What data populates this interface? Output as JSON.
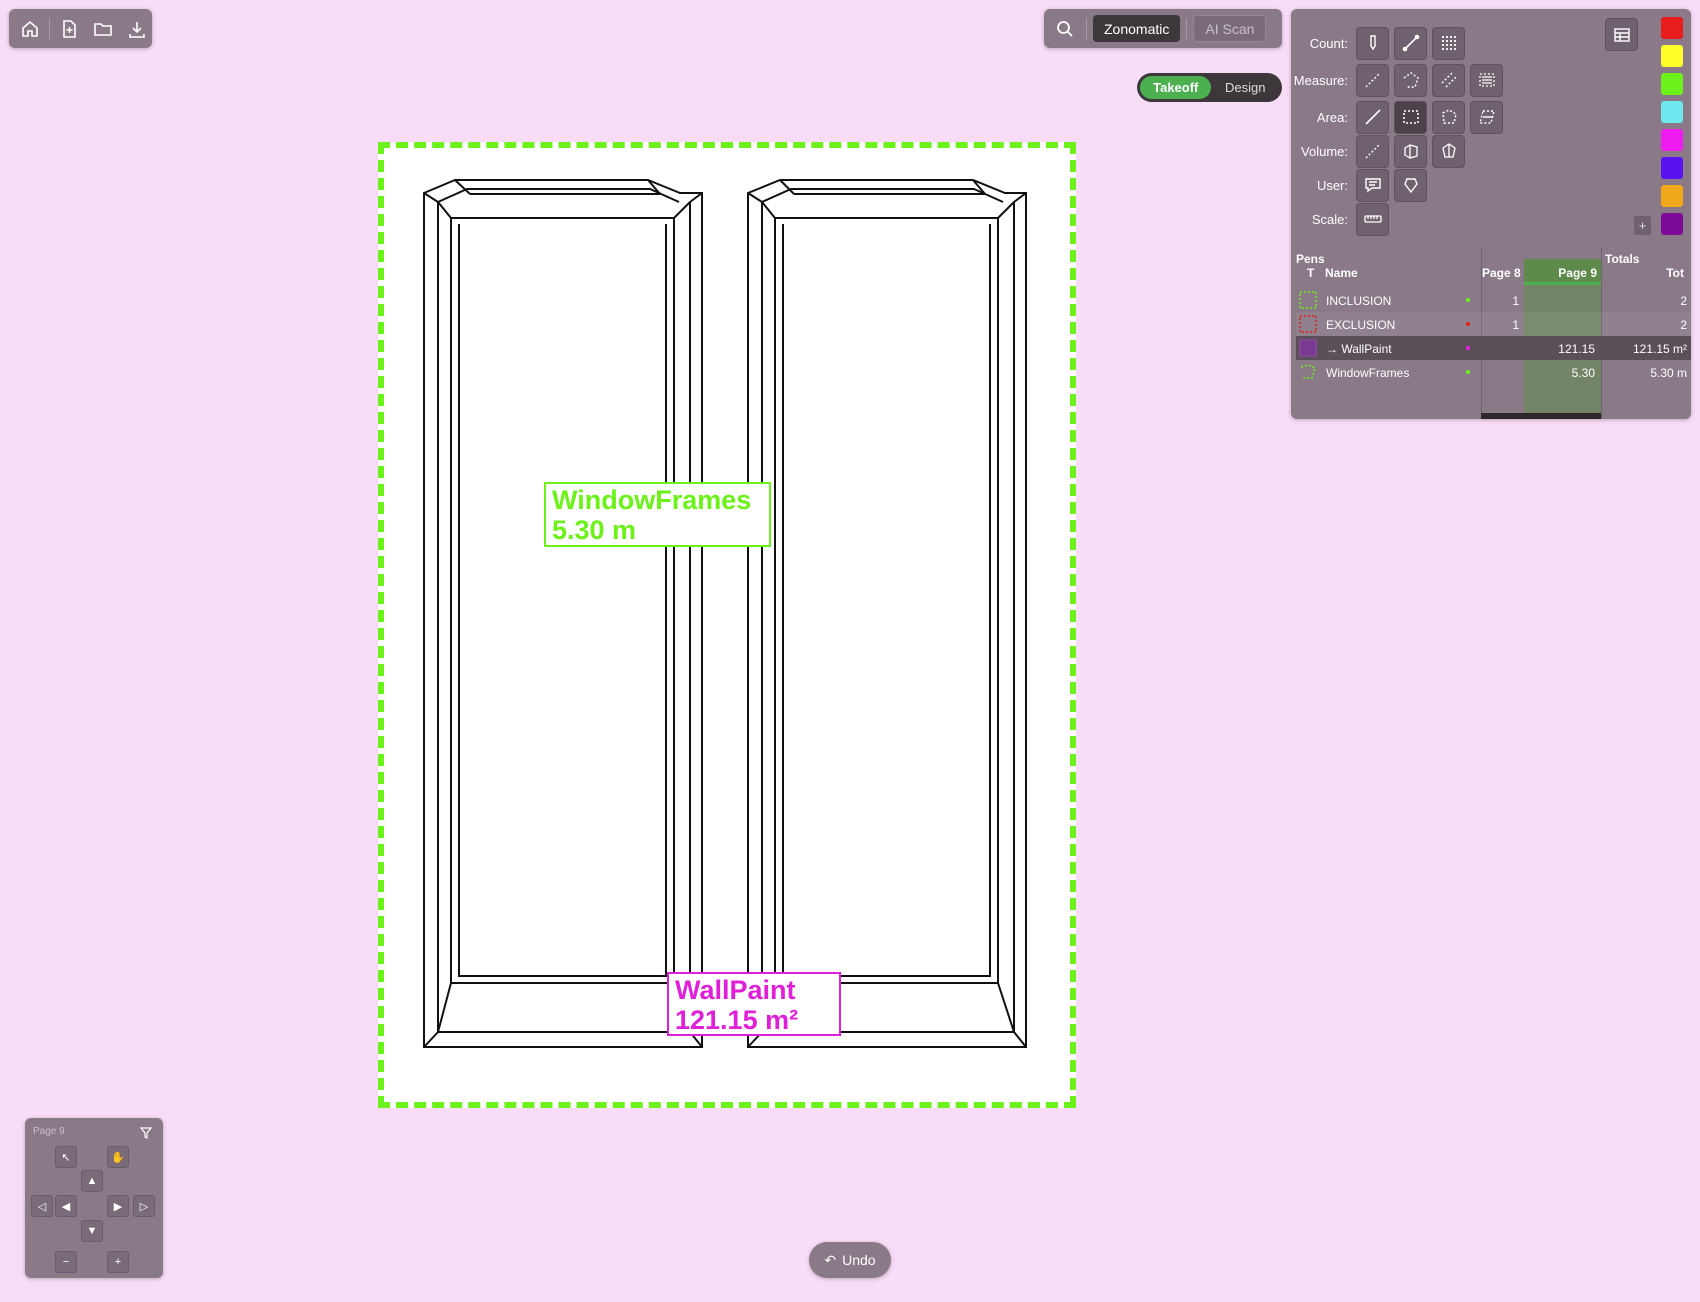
{
  "toolbar": {
    "icons": [
      "home-icon",
      "new-file-icon",
      "open-folder-icon",
      "download-icon"
    ]
  },
  "mode_bar": {
    "zonomatic_label": "Zonomatic",
    "ai_scan_label": "AI Scan"
  },
  "view_toggle": {
    "takeoff_label": "Takeoff",
    "design_label": "Design",
    "active": "Takeoff"
  },
  "tools": {
    "count_label": "Count:",
    "measure_label": "Measure:",
    "area_label": "Area:",
    "volume_label": "Volume:",
    "user_label": "User:",
    "scale_label": "Scale:",
    "add_color_label": "+"
  },
  "colors": {
    "swatches": [
      "#e81c1c",
      "#ffff2a",
      "#6cf21a",
      "#6ee8ee",
      "#ee1cee",
      "#5a12f0",
      "#f0a818",
      "#7e0a9a"
    ],
    "inclusion": "#6cf21a",
    "wallpaint": "#e020d8"
  },
  "pens": {
    "title": "Pens",
    "page8_header": "Page 8",
    "page9_header": "Page 9",
    "totals_header": "Totals",
    "col_type": "T",
    "col_name": "Name",
    "col_tot": "Tot",
    "rows": [
      {
        "name": "INCLUSION",
        "page8": "1",
        "page9": "",
        "total": "2",
        "dot": "#6cf21a"
      },
      {
        "name": "EXCLUSION",
        "page8": "1",
        "page9": "",
        "total": "2",
        "dot": "#e81c1c"
      },
      {
        "name": "→ WallPaint",
        "page8": "",
        "page9": "121.15",
        "total": "121.15 m²",
        "dot": "#ee1cee"
      },
      {
        "name": "WindowFrames",
        "page8": "",
        "page9": "5.30",
        "total": "5.30 m",
        "dot": "#6cf21a"
      }
    ]
  },
  "canvas": {
    "window_frames_name": "WindowFrames",
    "window_frames_value": "5.30 m",
    "wallpaint_name": "WallPaint",
    "wallpaint_value": "121.15 m²"
  },
  "nav": {
    "page_label": "Page 9",
    "zoom_out": "−",
    "zoom_in": "+"
  },
  "undo_label": "Undo"
}
